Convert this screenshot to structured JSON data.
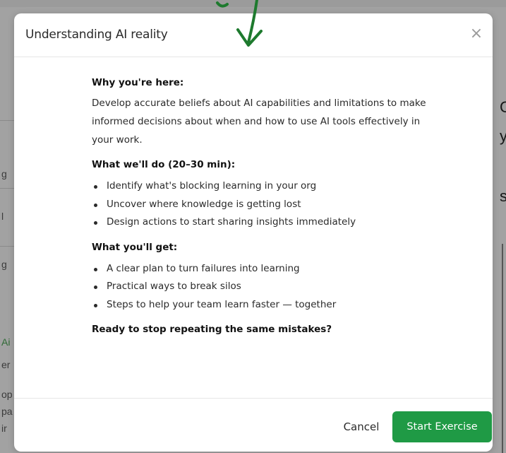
{
  "background": {
    "left_fragments": [
      "g",
      "l",
      "g",
      "Ai",
      "er",
      "op",
      "pa",
      "ir"
    ],
    "right_fragments": [
      "C",
      "y",
      "s"
    ]
  },
  "modal": {
    "title": "Understanding AI reality",
    "close_glyph": "×",
    "sections": [
      {
        "heading": "Why you're here:",
        "paragraph": "Develop accurate beliefs about AI capabilities and limitations to make informed decisions about when and how to use AI tools effectively in your work."
      },
      {
        "heading": "What we'll do (20–30 min):",
        "bullets": [
          "Identify what's blocking learning in your org",
          "Uncover where knowledge is getting lost",
          "Design actions to start sharing insights immediately"
        ]
      },
      {
        "heading": "What you'll get:",
        "bullets": [
          "A clear plan to turn failures into learning",
          "Practical ways to break silos",
          "Steps to help your team learn faster — together"
        ]
      },
      {
        "heading": "Ready to stop repeating the same mistakes?"
      }
    ],
    "footer": {
      "cancel_label": "Cancel",
      "start_label": "Start Exercise"
    }
  },
  "colors": {
    "accent": "#1f9a45",
    "annotation_arrow": "#1e7a2e"
  },
  "icons": {
    "close": "close-icon",
    "annotation": "arrow-down-annotation-icon"
  }
}
